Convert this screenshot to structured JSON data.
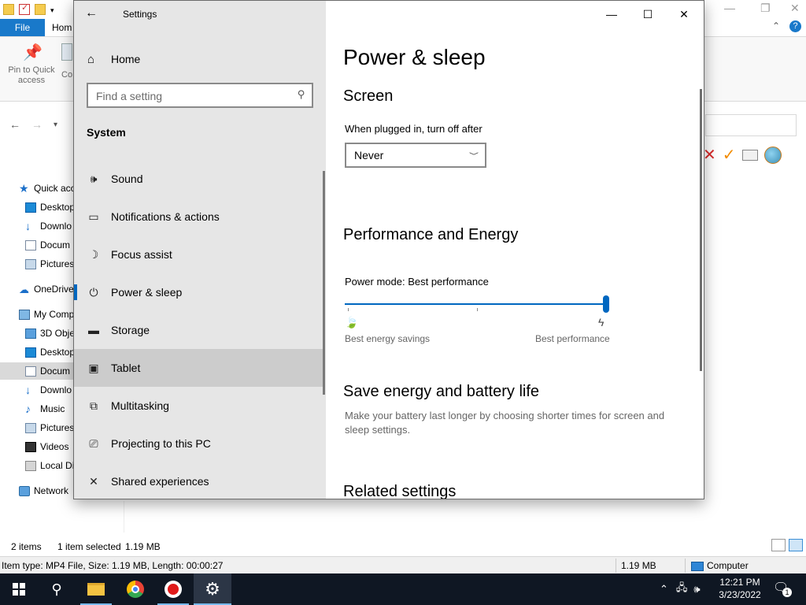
{
  "explorer": {
    "tab_file": "File",
    "tab_home": "Hom",
    "pin_label": "Pin to Quick access",
    "copy_label": "Co",
    "tree": [
      {
        "label": "Quick acc",
        "icon": "star-icon"
      },
      {
        "label": "Desktop",
        "icon": "desktop-icon"
      },
      {
        "label": "Downlo",
        "icon": "downloads-icon"
      },
      {
        "label": "Docum",
        "icon": "documents-icon"
      },
      {
        "label": "Pictures",
        "icon": "pictures-icon"
      },
      {
        "label": "OneDrive",
        "icon": "cloud-icon"
      },
      {
        "label": "My Comp",
        "icon": "computer-icon"
      },
      {
        "label": "3D Obje",
        "icon": "cube-icon"
      },
      {
        "label": "Desktop",
        "icon": "desktop-icon"
      },
      {
        "label": "Docum",
        "icon": "documents-icon"
      },
      {
        "label": "Downlo",
        "icon": "downloads-icon"
      },
      {
        "label": "Music",
        "icon": "music-icon"
      },
      {
        "label": "Pictures",
        "icon": "pictures-icon"
      },
      {
        "label": "Videos",
        "icon": "videos-icon"
      },
      {
        "label": "Local Di",
        "icon": "drive-icon"
      },
      {
        "label": "Network",
        "icon": "network-icon"
      }
    ],
    "status": {
      "items": "2 items",
      "selected": "1 item selected",
      "size": "1.19 MB"
    },
    "info": {
      "item_type": "Item type: MP4 File, Size: 1.19 MB, Length: 00:00:27",
      "size": "1.19 MB",
      "location": "Computer"
    }
  },
  "settings": {
    "window_title": "Settings",
    "home_label": "Home",
    "search_placeholder": "Find a setting",
    "section": "System",
    "nav_items": [
      {
        "label": "Sound",
        "icon": "speaker-icon"
      },
      {
        "label": "Notifications & actions",
        "icon": "notification-icon"
      },
      {
        "label": "Focus assist",
        "icon": "moon-icon"
      },
      {
        "label": "Power & sleep",
        "icon": "power-icon"
      },
      {
        "label": "Storage",
        "icon": "storage-icon"
      },
      {
        "label": "Tablet",
        "icon": "tablet-icon"
      },
      {
        "label": "Multitasking",
        "icon": "multitasking-icon"
      },
      {
        "label": "Projecting to this PC",
        "icon": "projecting-icon"
      },
      {
        "label": "Shared experiences",
        "icon": "shared-icon"
      }
    ],
    "active_item": "Power & sleep",
    "hover_item": "Tablet",
    "page_title": "Power & sleep",
    "screen_heading": "Screen",
    "plugged_label": "When plugged in, turn off after",
    "plugged_value": "Never",
    "perf_heading": "Performance and Energy",
    "power_mode_label": "Power mode: Best performance",
    "power_mode_level": 1.0,
    "slider_left_label": "Best energy savings",
    "slider_right_label": "Best performance",
    "save_heading": "Save energy and battery life",
    "save_desc": "Make your battery last longer by choosing shorter times for screen and sleep settings.",
    "related_heading": "Related settings",
    "accent_color": "#0067c0"
  },
  "taskbar": {
    "time": "12:21 PM",
    "date": "3/23/2022",
    "notification_count": "1"
  }
}
